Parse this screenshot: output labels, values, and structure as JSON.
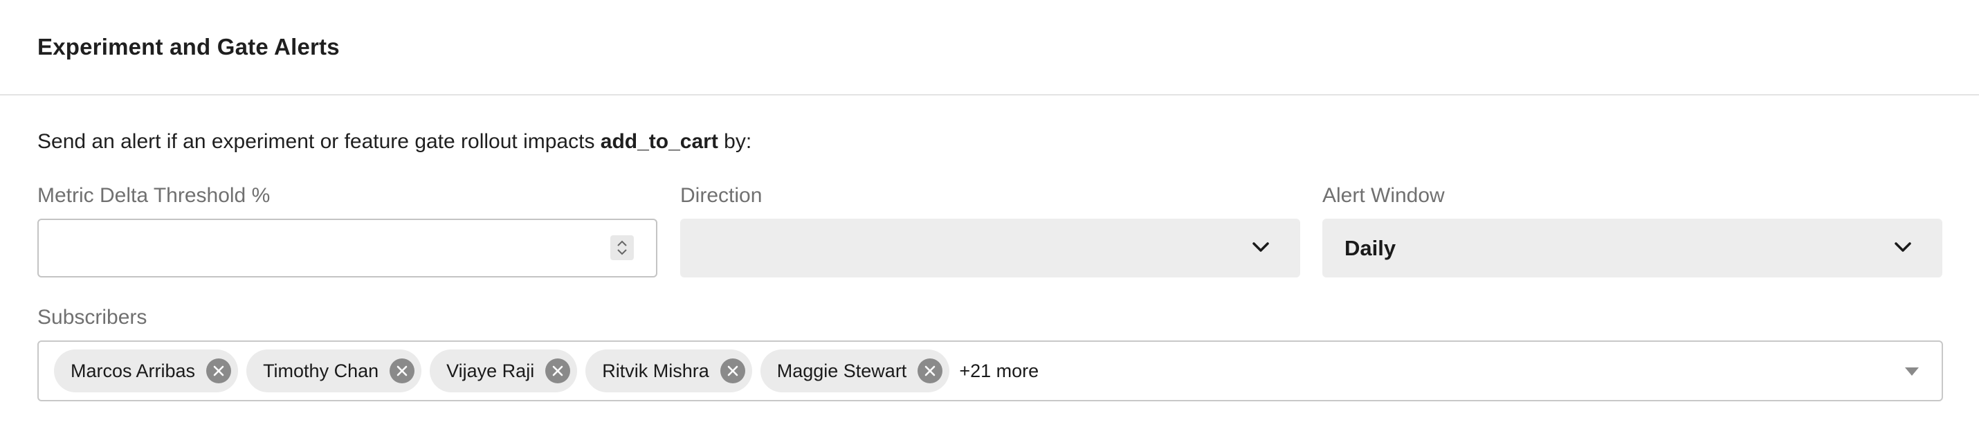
{
  "header": {
    "title": "Experiment and Gate Alerts"
  },
  "description": {
    "prefix": "Send an alert if an experiment or feature gate rollout impacts ",
    "metric": "add_to_cart",
    "suffix": " by:"
  },
  "threshold": {
    "label": "Metric Delta Threshold %",
    "value": "",
    "placeholder": ""
  },
  "direction": {
    "label": "Direction",
    "value": ""
  },
  "alert_window": {
    "label": "Alert Window",
    "value": "Daily"
  },
  "subscribers": {
    "label": "Subscribers",
    "items": [
      {
        "name": "Marcos Arribas"
      },
      {
        "name": "Timothy Chan"
      },
      {
        "name": "Vijaye Raji"
      },
      {
        "name": "Ritvik Mishra"
      },
      {
        "name": "Maggie Stewart"
      }
    ],
    "more": "+21 more"
  },
  "icons": {
    "stepper": "stepper-icon",
    "chevron": "chevron-down-icon",
    "remove": "close-circle-icon",
    "caret": "caret-down-icon"
  },
  "colors": {
    "label_gray": "#707070",
    "select_bg": "#ededed",
    "chip_bg": "#ebebeb",
    "chip_remove": "#8a8a8a"
  }
}
